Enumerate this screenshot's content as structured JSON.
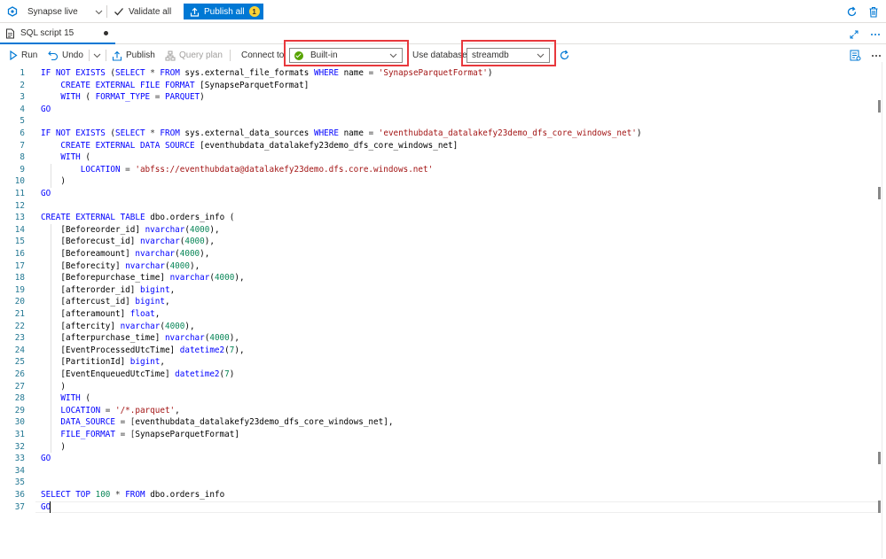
{
  "topbar": {
    "workspace_mode": "Synapse live",
    "validate_all": "Validate all",
    "publish_all": "Publish all",
    "publish_count": "1"
  },
  "tab": {
    "title": "SQL script 15"
  },
  "toolbar": {
    "run": "Run",
    "undo": "Undo",
    "publish": "Publish",
    "query_plan": "Query plan",
    "connect_to_label": "Connect to",
    "connect_to_value": "Built-in",
    "use_database_label": "Use database",
    "use_database_value": "streamdb"
  },
  "editor": {
    "lines": [
      {
        "n": "1",
        "text": "IF NOT EXISTS (SELECT * FROM sys.external_file_formats WHERE name = 'SynapseParquetFormat')"
      },
      {
        "n": "2",
        "text": "    CREATE EXTERNAL FILE FORMAT [SynapseParquetFormat]"
      },
      {
        "n": "3",
        "text": "    WITH ( FORMAT_TYPE = PARQUET)"
      },
      {
        "n": "4",
        "text": "GO"
      },
      {
        "n": "5",
        "text": ""
      },
      {
        "n": "6",
        "text": "IF NOT EXISTS (SELECT * FROM sys.external_data_sources WHERE name = 'eventhubdata_datalakefy23demo_dfs_core_windows_net')"
      },
      {
        "n": "7",
        "text": "    CREATE EXTERNAL DATA SOURCE [eventhubdata_datalakefy23demo_dfs_core_windows_net]"
      },
      {
        "n": "8",
        "text": "    WITH ("
      },
      {
        "n": "9",
        "text": "        LOCATION = 'abfss://eventhubdata@datalakefy23demo.dfs.core.windows.net'"
      },
      {
        "n": "10",
        "text": "    )"
      },
      {
        "n": "11",
        "text": "GO"
      },
      {
        "n": "12",
        "text": ""
      },
      {
        "n": "13",
        "text": "CREATE EXTERNAL TABLE dbo.orders_info ("
      },
      {
        "n": "14",
        "text": "    [Beforeorder_id] nvarchar(4000),"
      },
      {
        "n": "15",
        "text": "    [Beforecust_id] nvarchar(4000),"
      },
      {
        "n": "16",
        "text": "    [Beforeamount] nvarchar(4000),"
      },
      {
        "n": "17",
        "text": "    [Beforecity] nvarchar(4000),"
      },
      {
        "n": "18",
        "text": "    [Beforepurchase_time] nvarchar(4000),"
      },
      {
        "n": "19",
        "text": "    [afterorder_id] bigint,"
      },
      {
        "n": "20",
        "text": "    [aftercust_id] bigint,"
      },
      {
        "n": "21",
        "text": "    [afteramount] float,"
      },
      {
        "n": "22",
        "text": "    [aftercity] nvarchar(4000),"
      },
      {
        "n": "23",
        "text": "    [afterpurchase_time] nvarchar(4000),"
      },
      {
        "n": "24",
        "text": "    [EventProcessedUtcTime] datetime2(7),"
      },
      {
        "n": "25",
        "text": "    [PartitionId] bigint,"
      },
      {
        "n": "26",
        "text": "    [EventEnqueuedUtcTime] datetime2(7)"
      },
      {
        "n": "27",
        "text": "    )"
      },
      {
        "n": "28",
        "text": "    WITH ("
      },
      {
        "n": "29",
        "text": "    LOCATION = '/*.parquet',"
      },
      {
        "n": "30",
        "text": "    DATA_SOURCE = [eventhubdata_datalakefy23demo_dfs_core_windows_net],"
      },
      {
        "n": "31",
        "text": "    FILE_FORMAT = [SynapseParquetFormat]"
      },
      {
        "n": "32",
        "text": "    )"
      },
      {
        "n": "33",
        "text": "GO"
      },
      {
        "n": "34",
        "text": ""
      },
      {
        "n": "35",
        "text": ""
      },
      {
        "n": "36",
        "text": "SELECT TOP 100 * FROM dbo.orders_info"
      },
      {
        "n": "37",
        "text": "GO"
      }
    ]
  },
  "colors": {
    "accent": "#0078d4",
    "badge": "#ffd335",
    "highlight_box": "#e8383d",
    "status_ok": "#57a300",
    "keyword": "#0000ff",
    "string": "#a31515",
    "number": "#098658",
    "line_number": "#237893"
  }
}
